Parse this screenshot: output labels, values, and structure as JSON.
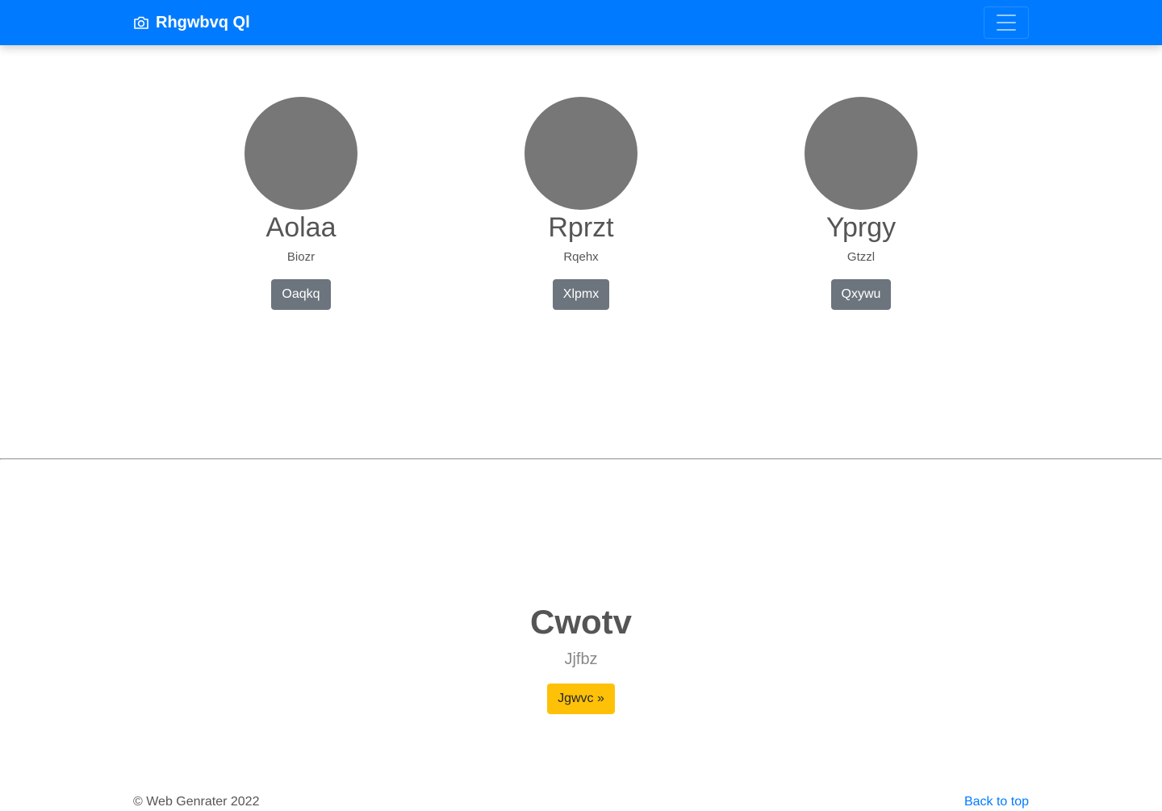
{
  "navbar": {
    "brand": "Rhgwbvq Ql",
    "brand_icon": "camera-icon",
    "toggler_icon": "hamburger-menu-icon"
  },
  "people": [
    {
      "name": "Aolaa",
      "role": "Biozr",
      "button": "Oaqkq"
    },
    {
      "name": "Rprzt",
      "role": "Rqehx",
      "button": "Xlpmx"
    },
    {
      "name": "Yprgy",
      "role": "Gtzzl",
      "button": "Qxywu"
    }
  ],
  "feature": {
    "title": "Cwotv",
    "subtitle": "Jjfbz",
    "button": "Jgwvc »"
  },
  "footer": {
    "copyright": "© Web Genrater 2022",
    "back_to_top": "Back to top"
  },
  "colors": {
    "primary": "#007bff",
    "secondary": "#6c757d",
    "warning": "#ffc107",
    "avatar": "#777777"
  }
}
